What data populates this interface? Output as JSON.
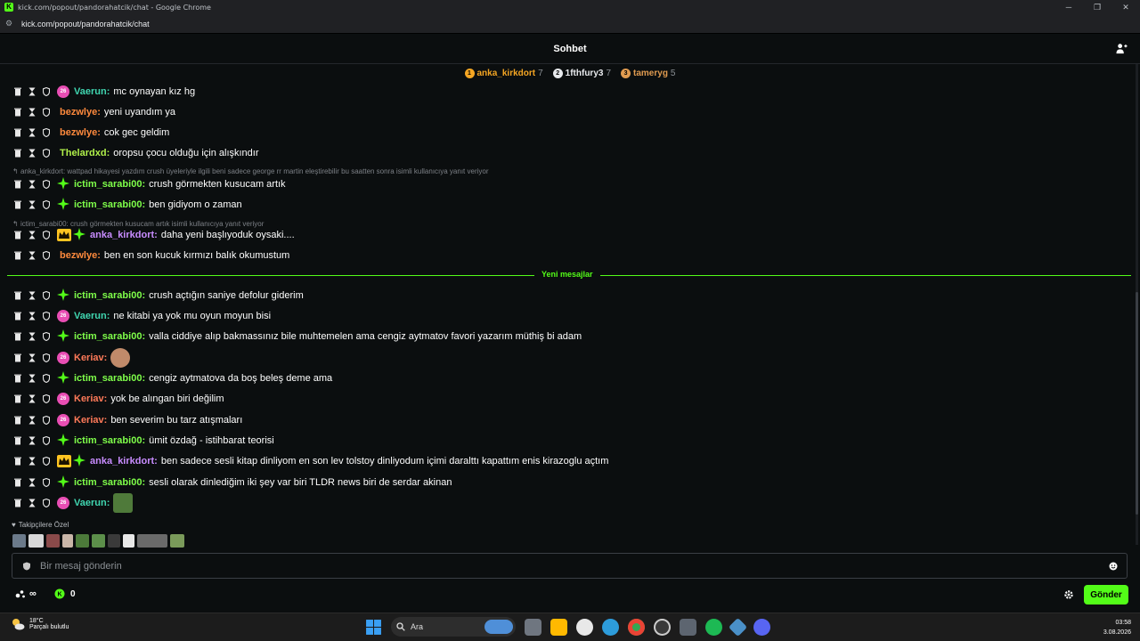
{
  "browser": {
    "window_title": "kick.com/popout/pandorahatcik/chat - Google Chrome",
    "url": "kick.com/popout/pandorahatcik/chat"
  },
  "chat": {
    "title": "Sohbet",
    "leaderboard": [
      {
        "rank": "1",
        "name": "anka_kirkdort",
        "count": "7",
        "color": "#f5a623"
      },
      {
        "rank": "2",
        "name": "1fthfury3",
        "count": "7",
        "color": "#e8eaed"
      },
      {
        "rank": "3",
        "name": "tameryg",
        "count": "5",
        "color": "#e09b50"
      }
    ],
    "messages": [
      {
        "user": "Vaerun",
        "color": "#40d6b0",
        "text": "mc oynayan kız hg",
        "badges": [
          "sub"
        ]
      },
      {
        "user": "bezwlye",
        "color": "#ff8a3d",
        "text": "yeni uyandım ya",
        "badges": []
      },
      {
        "user": "bezwlye",
        "color": "#ff8a3d",
        "text": "cok gec geldim",
        "badges": []
      },
      {
        "user": "Thelardxd",
        "color": "#b0f04a",
        "text": "oropsu çocu olduğu için alışkındır",
        "badges": []
      },
      {
        "reply_to": "anka_kirkdort: wattpad hikayesi yazdım crush üyeleriyle ilgili beni sadece george rr martin eleştirebilir bu saatten sonra isimli kullanıcıya yanıt veriyor"
      },
      {
        "user": "ictim_sarabi00",
        "color": "#7fff4a",
        "text": "crush görmekten kusucam artık",
        "badges": [
          "og"
        ]
      },
      {
        "user": "ictim_sarabi00",
        "color": "#7fff4a",
        "text": "ben gidiyom o zaman",
        "badges": [
          "og"
        ]
      },
      {
        "reply_to": "ictim_sarabi00: crush görmekten kusucam artık isimli kullanıcıya yanıt veriyor"
      },
      {
        "user": "anka_kirkdort",
        "color": "#c88cff",
        "text": "daha yeni başlıyoduk oysaki....",
        "badges": [
          "crown",
          "og"
        ]
      },
      {
        "user": "bezwlye",
        "color": "#ff8a3d",
        "text": "ben en son kucuk kırmızı balık okumustum",
        "badges": []
      },
      {
        "user": "ictim_sarabi00",
        "color": "#7fff4a",
        "text": "crush açtığın saniye defolur giderim",
        "badges": [
          "og"
        ]
      },
      {
        "user": "Vaerun",
        "color": "#40d6b0",
        "text": "ne kitabi ya yok mu oyun moyun bisi",
        "badges": [
          "sub"
        ]
      },
      {
        "user": "ictim_sarabi00",
        "color": "#7fff4a",
        "text": "valla ciddiye alıp bakmassınız bile muhtemelen ama cengiz aytmatov favori yazarım müthiş bi adam",
        "badges": [
          "og"
        ]
      },
      {
        "user": "Keriav",
        "color": "#ff7a59",
        "text": "",
        "badges": [
          "sub"
        ],
        "emote": "face-emote"
      },
      {
        "user": "ictim_sarabi00",
        "color": "#7fff4a",
        "text": "cengiz aytmatova da boş beleş deme ama",
        "badges": [
          "og"
        ]
      },
      {
        "user": "Keriav",
        "color": "#ff7a59",
        "text": "yok be alıngan biri değilim",
        "badges": [
          "sub"
        ]
      },
      {
        "user": "Keriav",
        "color": "#ff7a59",
        "text": "ben severim bu tarz atışmaları",
        "badges": [
          "sub"
        ]
      },
      {
        "user": "ictim_sarabi00",
        "color": "#7fff4a",
        "text": "ümit özdağ - istihbarat teorisi",
        "badges": [
          "og"
        ]
      },
      {
        "user": "anka_kirkdort",
        "color": "#c88cff",
        "text": "ben sadece sesli kitap dinliyom en son lev tolstoy dinliyodum içimi daralttı kapattım enis kirazoglu açtım",
        "badges": [
          "crown",
          "og"
        ]
      },
      {
        "user": "ictim_sarabi00",
        "color": "#7fff4a",
        "text": "sesli olarak dinlediğim iki şey var biri TLDR news biri de serdar akinan",
        "badges": [
          "og"
        ]
      },
      {
        "user": "Vaerun",
        "color": "#40d6b0",
        "text": "",
        "badges": [
          "sub"
        ],
        "emote": "pepe-emote"
      }
    ],
    "sub_badge_text": "26",
    "new_messages_label": "Yeni mesajlar",
    "followers_only_label": "Takipçilere Özel",
    "input_placeholder": "Bir mesaj gönderin",
    "points_left": "∞",
    "points_value": "0",
    "send_label": "Gönder"
  },
  "taskbar": {
    "temperature": "18°C",
    "condition": "Parçalı bulutlu",
    "search_label": "Ara",
    "time": "03:58",
    "date": "3.08.2026"
  }
}
